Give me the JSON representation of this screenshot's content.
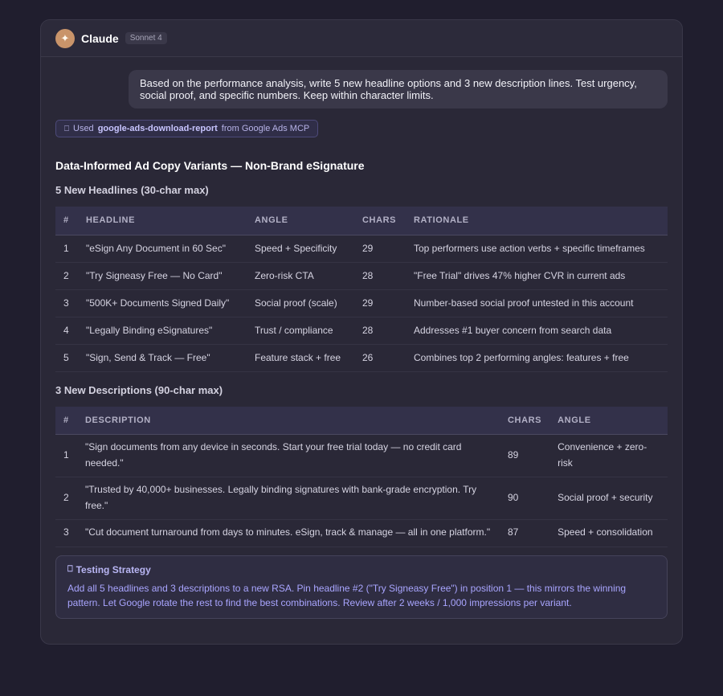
{
  "header": {
    "avatar_glyph": "✦",
    "app_name": "Claude",
    "model": "Sonnet 4"
  },
  "user_message": "Based on the performance analysis, write 5 new headline options and 3 new description lines. Test urgency, social proof, and specific numbers. Keep within character limits.",
  "tool_usage": {
    "icon": "tool-icon",
    "prefix": "Used",
    "tool_name": "google-ads-download-report",
    "suffix": "from Google Ads MCP"
  },
  "response": {
    "title": "Data-Informed Ad Copy Variants — Non-Brand eSignature",
    "headlines": {
      "heading": "5 New Headlines (30-char max)",
      "columns": [
        "#",
        "HEADLINE",
        "ANGLE",
        "CHARS",
        "RATIONALE"
      ],
      "rows": [
        [
          "1",
          "\"eSign Any Document in 60 Sec\"",
          "Speed + Specificity",
          "29",
          "Top performers use action verbs + specific timeframes"
        ],
        [
          "2",
          "\"Try Signeasy Free — No Card\"",
          "Zero-risk CTA",
          "28",
          "\"Free Trial\" drives 47% higher CVR in current ads"
        ],
        [
          "3",
          "\"500K+ Documents Signed Daily\"",
          "Social proof (scale)",
          "29",
          "Number-based social proof untested in this account"
        ],
        [
          "4",
          "\"Legally Binding eSignatures\"",
          "Trust / compliance",
          "28",
          "Addresses #1 buyer concern from search data"
        ],
        [
          "5",
          "\"Sign, Send & Track — Free\"",
          "Feature stack + free",
          "26",
          "Combines top 2 performing angles: features + free"
        ]
      ]
    },
    "descriptions": {
      "heading": "3 New Descriptions (90-char max)",
      "columns": [
        "#",
        "DESCRIPTION",
        "CHARS",
        "ANGLE"
      ],
      "rows": [
        [
          "1",
          "\"Sign documents from any device in seconds. Start your free trial today — no credit card needed.\"",
          "89",
          "Convenience + zero-risk"
        ],
        [
          "2",
          "\"Trusted by 40,000+ businesses. Legally binding signatures with bank-grade encryption. Try free.\"",
          "90",
          "Social proof + security"
        ],
        [
          "3",
          "\"Cut document turnaround from days to minutes. eSign, track & manage — all in one platform.\"",
          "87",
          "Speed + consolidation"
        ]
      ]
    },
    "callout": {
      "icon": "box-icon",
      "title": "Testing Strategy",
      "body": "Add all 5 headlines and 3 descriptions to a new RSA. Pin headline #2 (\"Try Signeasy Free\") in position 1 — this mirrors the winning pattern. Let Google rotate the rest to find the best combinations. Review after 2 weeks / 1,000 impressions per variant."
    }
  }
}
